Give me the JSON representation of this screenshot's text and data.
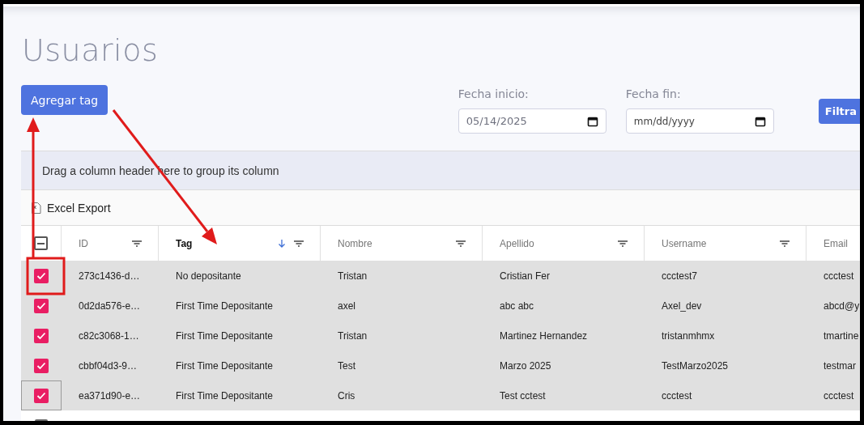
{
  "title": "Usuarios",
  "add_button": "Agregar tag",
  "date_fields": [
    {
      "label": "Fecha inicio:",
      "value": "05/14/2025"
    },
    {
      "label": "Fecha fin:",
      "placeholder": "mm/dd/yyyy"
    }
  ],
  "filter_button": "Filtra",
  "grid": {
    "group_panel": "Drag a column header here to group its column",
    "export_button": "Excel Export",
    "select_all_indeterminate": true,
    "columns": [
      {
        "label": "ID",
        "filter": true,
        "sorted": false
      },
      {
        "label": "Tag",
        "filter": true,
        "sorted": true
      },
      {
        "label": "Nombre",
        "filter": true,
        "sorted": false
      },
      {
        "label": "Apellido",
        "filter": true,
        "sorted": false
      },
      {
        "label": "Username",
        "filter": true,
        "sorted": false
      },
      {
        "label": "Email",
        "filter": false,
        "sorted": false
      }
    ],
    "rows": [
      {
        "selected": true,
        "focused": false,
        "cells": [
          "273c1436-d…",
          "No depositante",
          "Tristan",
          "Cristian Fer",
          "ccctest7",
          "ccctest"
        ]
      },
      {
        "selected": true,
        "focused": false,
        "cells": [
          "0d2da576-e…",
          "First Time Depositante",
          "axel",
          "abc abc",
          "Axel_dev",
          "abcd@y"
        ]
      },
      {
        "selected": true,
        "focused": false,
        "cells": [
          "c82c3068-1…",
          "First Time Depositante",
          "Tristan",
          "Martinez Hernandez",
          "tristanmhmx",
          "tmartine"
        ]
      },
      {
        "selected": true,
        "focused": false,
        "cells": [
          "cbbf04d3-9…",
          "First Time Depositante",
          "Test",
          "Marzo 2025",
          "TestMarzo2025",
          "testmar"
        ]
      },
      {
        "selected": true,
        "focused": true,
        "cells": [
          "ea371d90-e…",
          "First Time Depositante",
          "Cris",
          "Test cctest",
          "ccctest",
          "ccctest"
        ]
      },
      {
        "selected": false,
        "focused": false
      }
    ]
  }
}
